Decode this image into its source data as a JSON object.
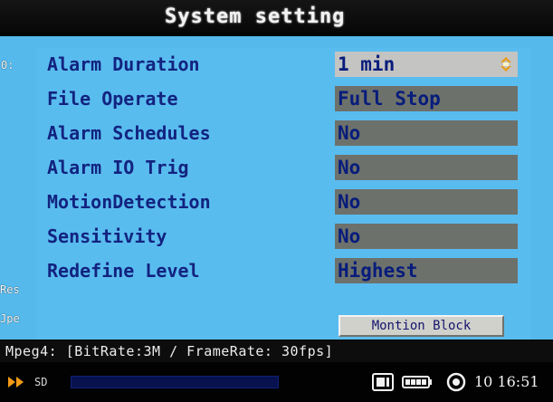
{
  "header": {
    "title": "System setting"
  },
  "background_labels": {
    "left_top": "0:",
    "left_mid": "Res",
    "left_bottom": "Jpe"
  },
  "settings": [
    {
      "label": "Alarm Duration",
      "value": "1 min",
      "control": "spinner",
      "icon": "updown-arrows-icon"
    },
    {
      "label": "File Operate",
      "value": "Full Stop"
    },
    {
      "label": "Alarm Schedules",
      "value": "No"
    },
    {
      "label": "Alarm IO Trig",
      "value": "No"
    },
    {
      "label": "MotionDetection",
      "value": "No"
    },
    {
      "label": "Sensitivity",
      "value": "No"
    },
    {
      "label": "Redefine Level",
      "value": "Highest"
    }
  ],
  "buttons": {
    "motion_block": "Montion Block"
  },
  "info_bar": {
    "text": "Mpeg4: [BitRate:3M / FrameRate: 30fps]"
  },
  "status_bar": {
    "play_icon": "play-indicator-icon",
    "storage_label": "SD",
    "progress_fraction": 0.0,
    "disk_icon": "sd-card-icon",
    "battery_icon": "battery-icon",
    "record_icon": "record-icon",
    "clock": "10 16:51"
  },
  "colors": {
    "panel_blue": "#55b9ec",
    "label_navy": "#12237f",
    "value_gray": "#6d716b",
    "selected_value": "#c4c4c2",
    "play_orange": "#f49b18"
  }
}
